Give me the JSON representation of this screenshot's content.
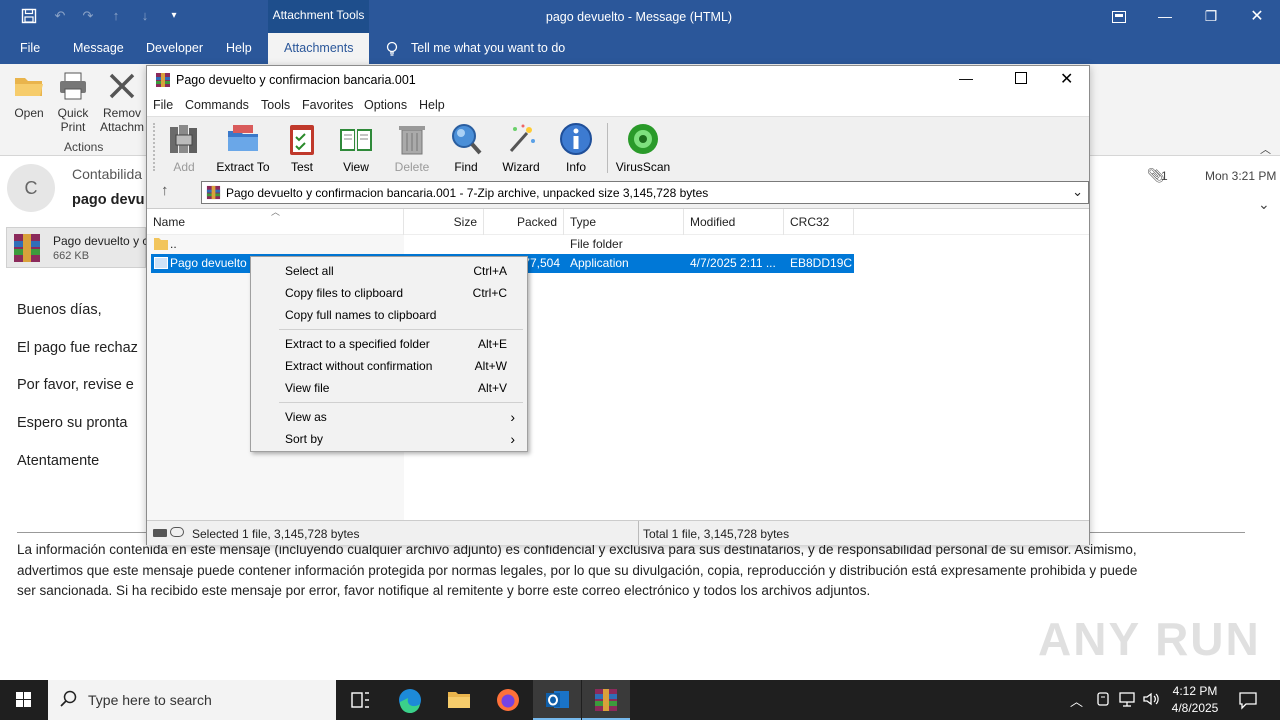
{
  "outlook": {
    "context_tab": "Attachment Tools",
    "window_title": "pago devuelto  -  Message (HTML)",
    "tabs": [
      "File",
      "Message",
      "Developer",
      "Help",
      "Attachments"
    ],
    "tell_me": "Tell me what you want to do",
    "ribbon": {
      "open": "Open",
      "quick_print_1": "Quick",
      "quick_print_2": "Print",
      "remove_1": "Remov",
      "remove_2": "Attachm",
      "group_actions": "Actions"
    },
    "avatar_initial": "C",
    "sender": "Contabilida",
    "subject": "pago devu",
    "attachment_count": "1",
    "received": "Mon 3:21 PM",
    "attachment_name": "Pago devuelto y c",
    "attachment_size": "662 KB",
    "body_lines": [
      "Buenos días,",
      "El pago fue rechaz",
      "Por favor, revise e",
      "Espero su pronta",
      "Atentamente"
    ],
    "disclaimer_1": "La información contenida en este mensaje (incluyendo cualquier archivo adjunto) es confidencial y exclusiva para sus destinatarios, y de responsabilidad personal de su emisor. Asimismo,",
    "disclaimer_2": "advertimos que este mensaje puede contener información protegida por normas legales, por lo que su divulgación, copia, reproducción y distribución está expresamente prohibida y puede",
    "disclaimer_3": "ser sancionada. Si ha recibido este mensaje por error, favor notifique al remitente y borre este correo electrónico y todos los archivos adjuntos."
  },
  "winrar": {
    "title": "Pago devuelto y confirmacion bancaria.001",
    "menu": [
      "File",
      "Commands",
      "Tools",
      "Favorites",
      "Options",
      "Help"
    ],
    "toolbar": {
      "add": "Add",
      "extract_to": "Extract To",
      "test": "Test",
      "view": "View",
      "delete": "Delete",
      "find": "Find",
      "wizard": "Wizard",
      "info": "Info",
      "virusscan": "VirusScan"
    },
    "path": "Pago devuelto y confirmacion bancaria.001 - 7-Zip archive, unpacked size 3,145,728 bytes",
    "columns": [
      "Name",
      "Size",
      "Packed",
      "Type",
      "Modified",
      "CRC32"
    ],
    "rows": [
      {
        "name": "..",
        "size": "",
        "packed": "",
        "type": "File folder",
        "modified": "",
        "crc": ""
      },
      {
        "name": "Pago devuelto y",
        "size": "",
        "packed": "77,504",
        "type": "Application",
        "modified": "4/7/2025 2:11 ...",
        "crc": "EB8DD19C"
      }
    ],
    "status_left": "Selected 1 file, 3,145,728 bytes",
    "status_right": "Total 1 file, 3,145,728 bytes"
  },
  "context_menu": {
    "items": [
      {
        "label": "Select all",
        "key": "Ctrl+A"
      },
      {
        "label": "Copy files to clipboard",
        "key": "Ctrl+C"
      },
      {
        "label": "Copy full names to clipboard",
        "key": ""
      },
      {
        "label": "Extract to a specified folder",
        "key": "Alt+E"
      },
      {
        "label": "Extract without confirmation",
        "key": "Alt+W"
      },
      {
        "label": "View file",
        "key": "Alt+V"
      },
      {
        "label": "View as",
        "key": "›"
      },
      {
        "label": "Sort by",
        "key": "›"
      }
    ]
  },
  "taskbar": {
    "search_placeholder": "Type here to search",
    "time": "4:12 PM",
    "date": "4/8/2025"
  },
  "watermark": "ANY RUN"
}
